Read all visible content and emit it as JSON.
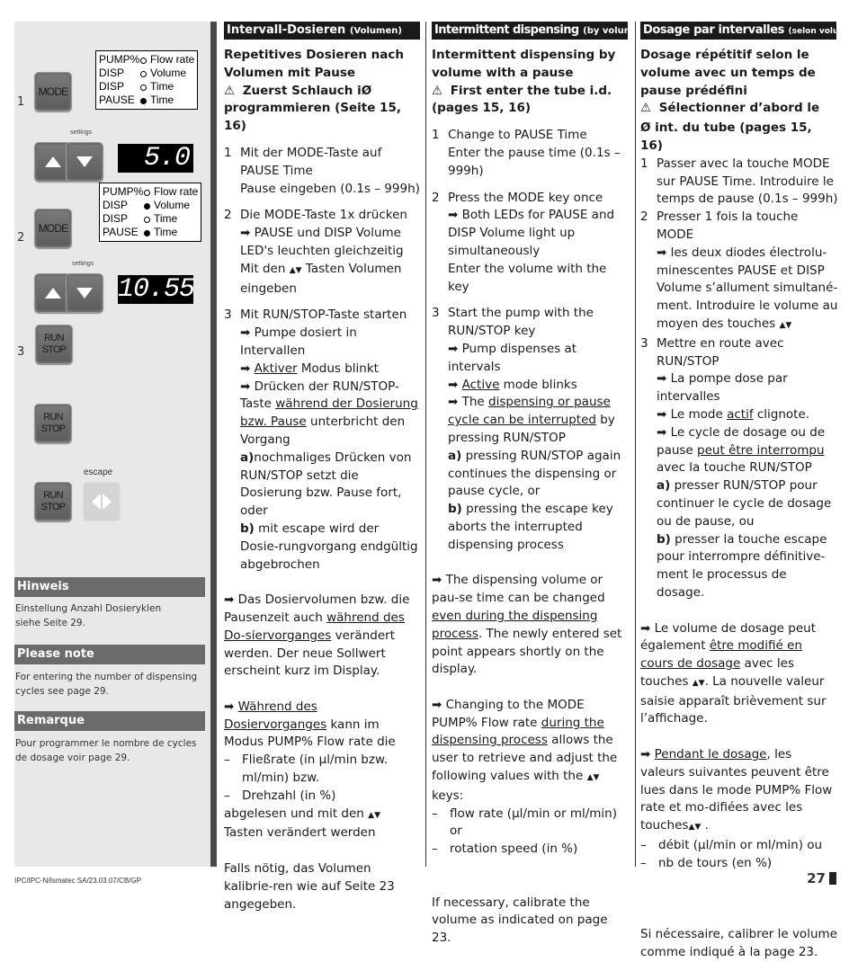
{
  "left_panel": {
    "steps": [
      {
        "number": "1"
      },
      {
        "number": "2"
      },
      {
        "number": "3"
      }
    ],
    "keys": {
      "mode": "MODE",
      "run": "RUN",
      "stop": "STOP",
      "settings_label": "settings",
      "escape_label": "escape"
    },
    "led_panel_1": [
      {
        "mode": "PUMP%",
        "led": "off",
        "label": "Flow rate"
      },
      {
        "mode": "DISP",
        "led": "off",
        "label": "Volume"
      },
      {
        "mode": "DISP",
        "led": "off",
        "label": "Time"
      },
      {
        "mode": "PAUSE",
        "led": "on",
        "label": "Time"
      }
    ],
    "led_panel_2": [
      {
        "mode": "PUMP%",
        "led": "off",
        "label": "Flow rate"
      },
      {
        "mode": "DISP",
        "led": "on",
        "label": "Volume"
      },
      {
        "mode": "DISP",
        "led": "off",
        "label": "Time"
      },
      {
        "mode": "PAUSE",
        "led": "on",
        "label": "Time"
      }
    ],
    "display_1": "5.0",
    "display_2": "10.55",
    "notes": [
      {
        "title": "Hinweis",
        "text": "Einstellung Anzahl Dosieryklen siehe Seite 29."
      },
      {
        "title": "Please note",
        "text": "For entering the number of dispensing cycles see page 29."
      },
      {
        "title": "Remarque",
        "text": "Pour programmer le nombre de cycles de dosage voir page 29."
      }
    ]
  },
  "columns": {
    "de": {
      "header": "Intervall-Dosieren",
      "header_small": "(Volumen)",
      "intro1": "Repetitives Dosieren nach Volumen mit Pause",
      "intro2": "Zuerst Schlauch iØ programmieren (Seite 15, 16)",
      "s1_n": "1",
      "s1_a": "Mit der MODE-Taste auf PAUSE Time",
      "s1_b": "Pause eingeben (0.1s – 999h)",
      "s2_n": "2",
      "s2_a": "Die MODE-Taste 1x drücken",
      "s2_b": "PAUSE und DISP Volume LED's leuchten gleichzeitig",
      "s2_c1": "Mit den",
      "s2_c2": "Tasten Volumen eingeben",
      "s3_n": "3",
      "s3_a": "Mit RUN/STOP-Taste starten",
      "s3_b": "Pumpe dosiert in Intervallen",
      "s3_c_u": "Aktiver",
      "s3_c": " Modus blinkt",
      "s3_d1": "Drücken der RUN/STOP-Taste ",
      "s3_d_u": "während der Dosierung bzw. Pause",
      "s3_d2": " unterbricht den Vorgang",
      "s3_e_b": "a)",
      "s3_e": "nochmaliges Drücken von RUN/STOP setzt die Dosierung bzw. Pause fort, oder",
      "s3_f_b": "b)",
      "s3_f": " mit escape wird der Dosie-rungvorgang endgültig abgebrochen",
      "p1_a": "Das Dosiervolumen bzw. die Pausenzeit auch ",
      "p1_u": "während des Do-siervorganges",
      "p1_b": " verändert werden. Der neue Sollwert erscheint kurz im Display.",
      "p2_u": "Während des Dosiervorganges",
      "p2_a": " kann im Modus PUMP% Flow rate die",
      "p2_d1": "Fließrate (in µl/min bzw. ml/min) bzw.",
      "p2_d2": "Drehzahl (in %)",
      "p2_b1": "abgelesen und mit den",
      "p2_b2": "Tasten verändert werden",
      "p3": "Falls nötig, das Volumen kalibrie-ren wie auf Seite 23 angegeben."
    },
    "en": {
      "header": "Intermittent dispensing",
      "header_small": "(by volume)",
      "intro1": "Intermittent dispensing by volume with a pause",
      "intro2": "First enter the tube i.d. (pages 15, 16)",
      "s1_n": "1",
      "s1_a": "Change to PAUSE Time",
      "s1_b": "Enter the pause time (0.1s – 999h)",
      "s2_n": "2",
      "s2_a": "Press the MODE key once",
      "s2_b": "Both LEDs for PAUSE and DISP Volume light up simultaneously",
      "s2_c": "Enter the volume with the key",
      "s3_n": "3",
      "s3_a": "Start the pump with the RUN/STOP key",
      "s3_b": "Pump dispenses at intervals",
      "s3_c_u": "Active",
      "s3_c": " mode blinks",
      "s3_d1": "The ",
      "s3_d_u": "dispensing or pause cycle can be interrupted",
      "s3_d2": " by pressing RUN/STOP",
      "s3_e_b": "a)",
      "s3_e": " pressing RUN/STOP again continues the dispensing or pause cycle, or",
      "s3_f_b": "b)",
      "s3_f": " pressing the escape key aborts the interrupted dispensing process",
      "p1_a": "The dispensing volume or pau-se time can be changed ",
      "p1_u": "even during the dispensing process",
      "p1_b": ". The newly entered set point appears shortly on the display.",
      "p2_a1": "Changing to the MODE PUMP% Flow rate ",
      "p2_u": "during the dispensing process",
      "p2_a2": " allows the user to retrieve and adjust the following values with the",
      "p2_a3": "keys:",
      "p2_d1": "flow rate (µl/min or ml/min) or",
      "p2_d2": "rotation speed (in %)",
      "p3": "If necessary, calibrate the volume as indicated on page 23."
    },
    "fr": {
      "header": "Dosage par intervalles",
      "header_small": "(selon volume)",
      "intro1": "Dosage répétitif selon le volume avec un temps de pause prédéfini",
      "intro2": "Sélectionner d’abord le",
      "intro3": "Ø int. du tube (pages 15, 16)",
      "s1_n": "1",
      "s1_a": "Passer avec la touche MODE sur PAUSE Time. Introduire le temps de pause  (0.1s – 999h)",
      "s2_n": "2",
      "s2_a": "Presser 1 fois la touche MODE",
      "s2_b": " les deux diodes électrolu-minescentes PAUSE et DISP Volume s’allument simultané-ment. Introduire le volume au moyen des touches",
      "s3_n": "3",
      "s3_a": "Mettre en route avec RUN/STOP",
      "s3_b": "La pompe dose par intervalles",
      "s3_c1": "Le mode ",
      "s3_c_u": "actif",
      "s3_c2": " clignote.",
      "s3_d1": "Le cycle de dosage ou de pause ",
      "s3_d_u": "peut être interrompu",
      "s3_d2": " avec la touche RUN/STOP",
      "s3_e_b": "a)",
      "s3_e": " presser RUN/STOP pour continuer le cycle de dosage ou de pause, ou",
      "s3_f_b": "b)",
      "s3_f": " presser la touche escape pour interrompre définitive-ment le processus de dosage.",
      "p1_a": "Le volume de dosage peut également ",
      "p1_u": "être modifié en cours de dosage",
      "p1_b": " avec les touches",
      "p1_c": ". La nouvelle valeur saisie apparaît brièvement sur l’affichage.",
      "p2_u": "Pendant le dosage",
      "p2_a": ", les valeurs suivantes peuvent être lues dans le mode PUMP% Flow rate et mo-difiées avec les touches",
      "p2_a2": ".",
      "p2_d1": "débit (µl/min or ml/min) ou",
      "p2_d2": "nb de tours (en %)",
      "p3": "Si nécessaire, calibrer le volume comme indiqué à la page 23."
    }
  },
  "glyphs": {
    "arrow": "➡",
    "updown": "▲▼",
    "warning": "⚠",
    "dash": "–"
  },
  "footer": {
    "code": "IPC/IPC-N/Ismatec SA/23.03.07/CB/GP",
    "page": "27"
  }
}
